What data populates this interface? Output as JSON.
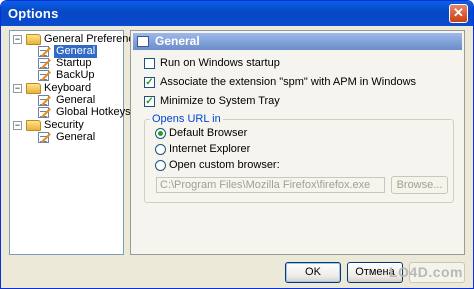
{
  "window": {
    "title": "Options",
    "close_glyph": "✕"
  },
  "tree": {
    "nodes": [
      {
        "label": "General Preferences",
        "expander": "⊟"
      },
      {
        "label": "General"
      },
      {
        "label": "Startup"
      },
      {
        "label": "BackUp"
      },
      {
        "label": "Keyboard",
        "expander": "⊟"
      },
      {
        "label": "General"
      },
      {
        "label": "Global Hotkeys"
      },
      {
        "label": "Security",
        "expander": "⊟"
      },
      {
        "label": "General"
      }
    ],
    "selected_index": 1
  },
  "section": {
    "title": "General"
  },
  "options": {
    "run_on_startup": {
      "label": "Run on Windows startup",
      "checked": false
    },
    "associate_spm": {
      "label": "Associate the extension \"spm\" with APM in Windows",
      "checked": true
    },
    "minimize_tray": {
      "label": "Minimize to System Tray",
      "checked": true
    }
  },
  "opens_url": {
    "group_title": "Opens URL in",
    "radios": [
      {
        "label": "Default Browser",
        "selected": true
      },
      {
        "label": "Internet Explorer",
        "selected": false
      },
      {
        "label": "Open custom browser:",
        "selected": false
      }
    ],
    "path_value": "C:\\Program Files\\Mozilla Firefox\\firefox.exe",
    "browse_label": "Browse..."
  },
  "footer": {
    "ok_label": "OK",
    "cancel_label": "Отмена"
  },
  "watermark": "LO4D.com",
  "colors": {
    "titlebar": "#0747c4",
    "selection": "#316ac5",
    "group_title": "#0046d5",
    "check": "#21a121"
  }
}
